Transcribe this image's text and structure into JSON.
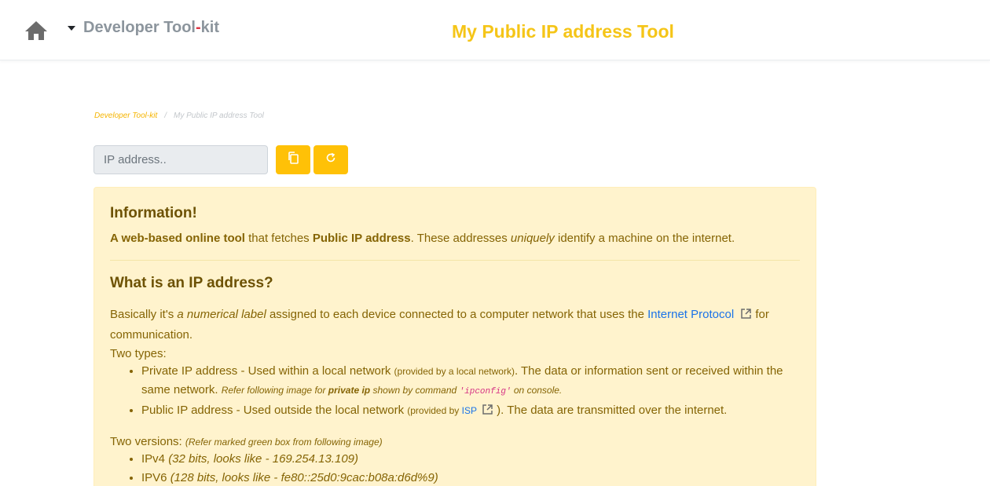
{
  "navbar": {
    "home_icon": "home-icon",
    "brand_left": "Developer Tool",
    "brand_dash": "-",
    "brand_right": "kit",
    "page_title": "My Public IP address Tool"
  },
  "breadcrumb": {
    "items": [
      "Developer Tool-kit",
      "My Public IP address Tool"
    ],
    "separator": "/"
  },
  "ip_input": {
    "placeholder": "IP address..",
    "value": ""
  },
  "buttons": {
    "copy_icon": "copy-icon",
    "refresh_icon": "refresh-icon"
  },
  "colors": {
    "accent": "#ffc107",
    "title": "#f5c518",
    "alert_bg": "#fff3cd",
    "alert_text": "#856404",
    "link": "#1a73e8"
  },
  "info": {
    "heading": "Information!",
    "p1_a": "A web-based online tool",
    "p1_b": " that fetches ",
    "p1_c": "Public IP address",
    "p1_d": ". These addresses ",
    "p1_e": "uniquely",
    "p1_f": " identify a machine on the internet.",
    "heading2": "What is an IP address?",
    "p2_a": "Basically it's ",
    "p2_b": "a numerical label",
    "p2_c": " assigned to each device connected to a computer network that uses the ",
    "p2_link": "Internet Protocol",
    "p2_d": " for communication.",
    "types_label": "Two types:",
    "type1_a": "Private IP address - Used within a local network ",
    "type1_b": "(provided by a local network)",
    "type1_c": ". The data or information sent or received within the same network. ",
    "type1_d": "Refer following image for ",
    "type1_e": "private ip",
    "type1_f": " shown by command ",
    "type1_code": "'ipconfig'",
    "type1_g": " on console.",
    "type2_a": "Public IP address - Used outside the local network ",
    "type2_b": "(provided by ",
    "type2_link": "ISP",
    "type2_c": " )",
    "type2_d": ". The data are transmitted over the internet.",
    "versions_label": "Two versions: ",
    "versions_note": "(Refer marked green box from following image)",
    "v4_a": "IPv4 ",
    "v4_b": "(32 bits, looks like - 169.254.13.109)",
    "v6_a": "IPV6 ",
    "v6_b": "(128 bits, looks like - fe80::25d0:9cac:b08a:d6d%9)"
  }
}
